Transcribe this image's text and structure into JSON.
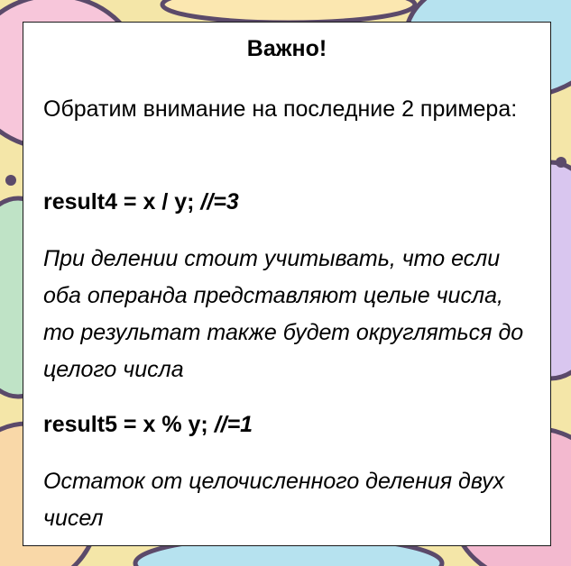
{
  "title": "Важно!",
  "intro": "Обратим внимание на последние 2 примера:",
  "example1": {
    "code": "result4 = x / y; ",
    "comment": "//=3",
    "explanation": "При делении стоит учитывать, что если оба операнда представляют целые числа, то результат также будет округляться до целого числа"
  },
  "example2": {
    "code": "result5 = x % y; ",
    "comment": "//=1",
    "explanation": "Остаток от целочисленного деления двух чисел"
  }
}
